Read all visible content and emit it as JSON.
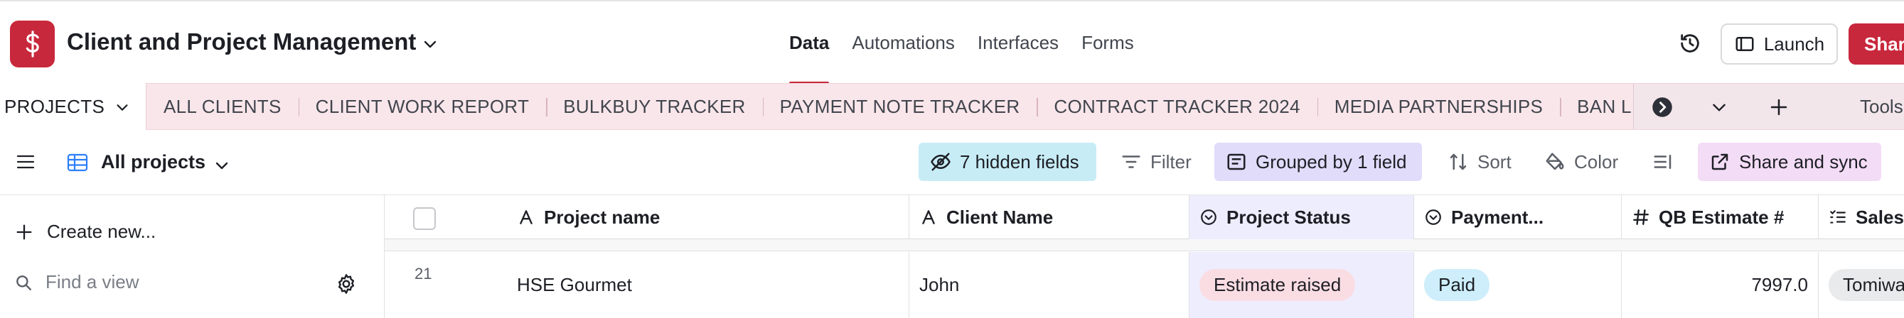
{
  "header": {
    "base_title": "Client and Project Management",
    "nav": [
      {
        "label": "Data",
        "active": true
      },
      {
        "label": "Automations",
        "active": false
      },
      {
        "label": "Interfaces",
        "active": false
      },
      {
        "label": "Forms",
        "active": false
      }
    ],
    "launch_label": "Launch",
    "share_label": "Share",
    "brand_color": "#c8283c"
  },
  "tables": {
    "active": "PROJECTS",
    "items": [
      "ALL CLIENTS",
      "CLIENT WORK REPORT",
      "BULKBUY TRACKER",
      "PAYMENT NOTE TRACKER",
      "CONTRACT TRACKER 2024",
      "MEDIA PARTNERSHIPS",
      "BAN LIST"
    ],
    "tools_label": "Tools"
  },
  "viewbar": {
    "view_name": "All projects",
    "hidden_fields": "7 hidden fields",
    "filter": "Filter",
    "grouped": "Grouped by 1 field",
    "sort": "Sort",
    "color": "Color",
    "share_sync": "Share and sync"
  },
  "sidebar": {
    "create_new": "Create new...",
    "find_placeholder": "Find a view"
  },
  "grid": {
    "columns": [
      {
        "label": "Project name",
        "icon": "text-field-icon"
      },
      {
        "label": "Client Name",
        "icon": "text-field-icon"
      },
      {
        "label": "Project Status",
        "icon": "single-select-icon"
      },
      {
        "label": "Payment...",
        "icon": "single-select-icon"
      },
      {
        "label": "QB Estimate #",
        "icon": "number-field-icon"
      },
      {
        "label": "Sales",
        "icon": "multi-select-icon"
      }
    ],
    "rows": [
      {
        "number": "21",
        "project_name": "HSE Gourmet",
        "client_name": "John",
        "project_status": "Estimate raised",
        "payment": "Paid",
        "qb_estimate": "7997.0",
        "sales": "Tomiwa"
      }
    ]
  }
}
